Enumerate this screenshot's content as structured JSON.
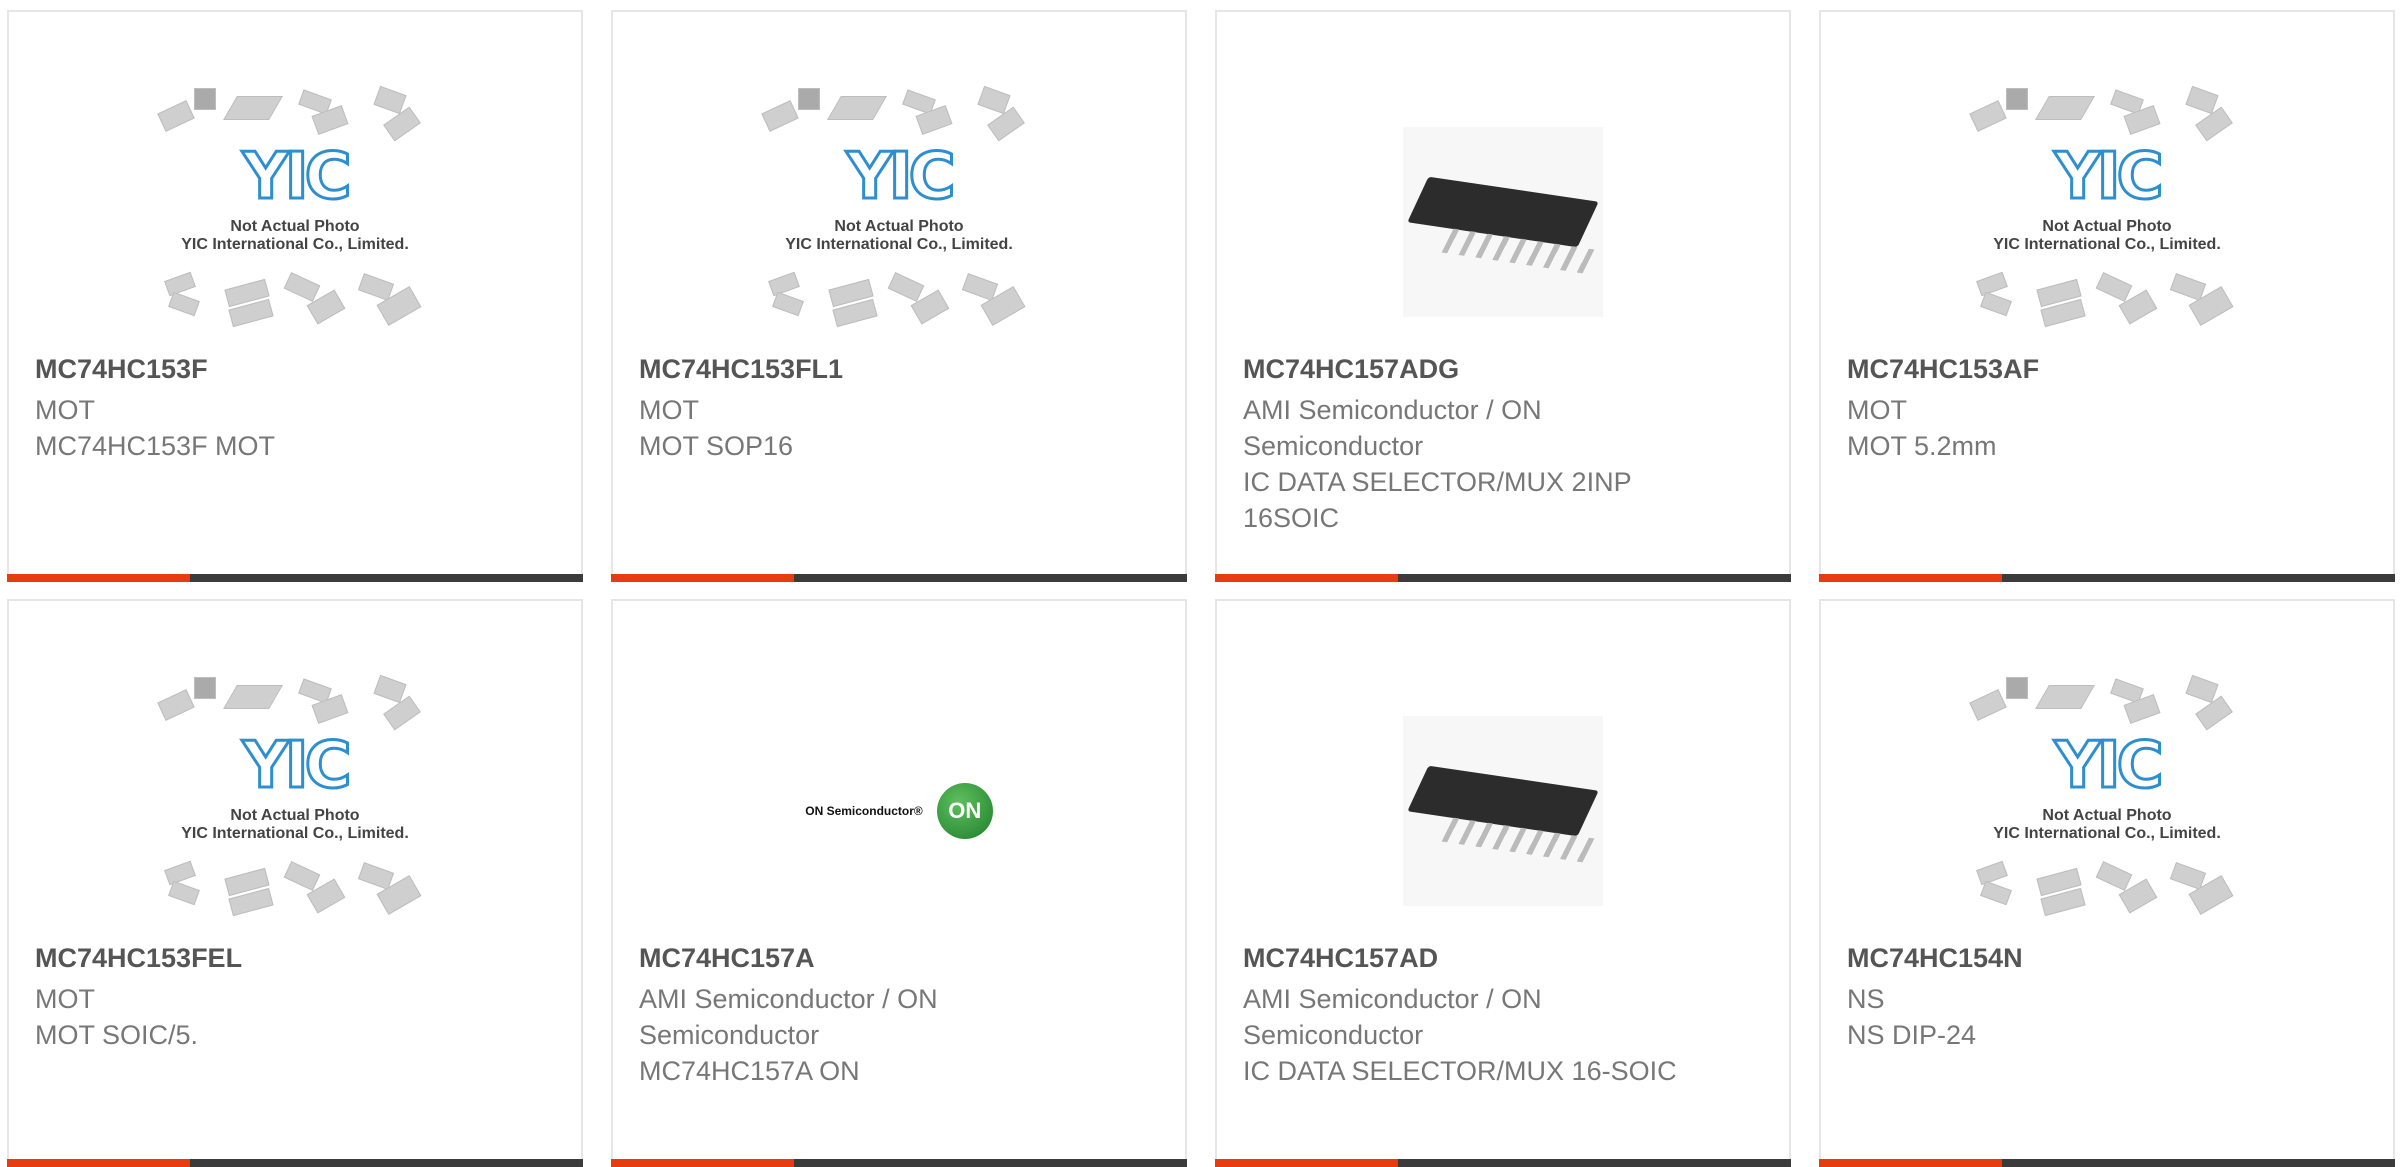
{
  "placeholder": {
    "line1": "Not Actual Photo",
    "line2": "YIC International Co., Limited.",
    "logo": "YIC"
  },
  "on_logo": {
    "wordmark": "ON Semiconductor®",
    "badge": "ON"
  },
  "products": [
    {
      "part": "MC74HC153F",
      "maker": "MOT",
      "desc": "MC74HC153F MOT",
      "image": "yic-placeholder"
    },
    {
      "part": "MC74HC153FL1",
      "maker": "MOT",
      "desc": "MOT SOP16",
      "image": "yic-placeholder"
    },
    {
      "part": "MC74HC157ADG",
      "maker": "AMI Semiconductor / ON Semiconductor",
      "desc": "IC DATA SELECTOR/MUX 2INP 16SOIC",
      "image": "soic-chip"
    },
    {
      "part": "MC74HC153AF",
      "maker": "MOT",
      "desc": "MOT 5.2mm",
      "image": "yic-placeholder"
    },
    {
      "part": "MC74HC153FEL",
      "maker": "MOT",
      "desc": "MOT SOIC/5.",
      "image": "yic-placeholder"
    },
    {
      "part": "MC74HC157A",
      "maker": "AMI Semiconductor / ON Semiconductor",
      "desc": "MC74HC157A ON",
      "image": "on-logo"
    },
    {
      "part": "MC74HC157AD",
      "maker": "AMI Semiconductor / ON Semiconductor",
      "desc": "IC DATA SELECTOR/MUX 16-SOIC",
      "image": "soic-chip"
    },
    {
      "part": "MC74HC154N",
      "maker": "NS",
      "desc": "NS DIP-24",
      "image": "yic-placeholder"
    }
  ],
  "colors": {
    "accent": "#e63c0f",
    "bar": "#3b3b3b"
  }
}
